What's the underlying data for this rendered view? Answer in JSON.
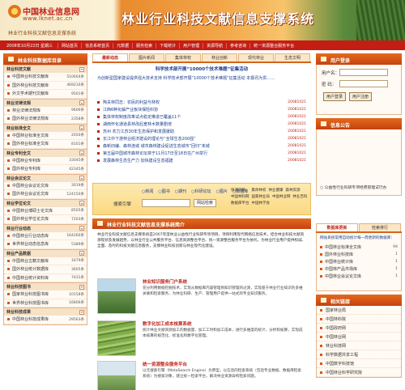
{
  "header": {
    "logo_name": "中国林业信息网",
    "logo_url": "www.lknet.ac.cn",
    "logo_slogan": "林业行业科技文献信息支撑系统",
    "title": "林业行业科技文献信息支撑系统"
  },
  "nav": {
    "date": "2008年10月22日 星期三",
    "items": [
      "网站首页",
      "信息系统首页",
      "元数据",
      "服务检索",
      "下载统计",
      "用户管理",
      "资源导航",
      "参考咨询",
      "统一资源整合服务平台"
    ]
  },
  "left": {
    "title": "林业科技数据库目录",
    "sections": [
      {
        "name": "林业科技文献",
        "rows": [
          {
            "t": "中国林业科技文献库",
            "n": "510604条"
          },
          {
            "t": "国外林业科技文献库",
            "n": "469210条"
          },
          {
            "t": "外文学术期刊文献库",
            "n": "9501条"
          }
        ]
      },
      {
        "name": "林业法律法规",
        "rows": [
          {
            "t": "林业法律法规库",
            "n": "9606条"
          },
          {
            "t": "国外林业法律法规库",
            "n": "2358条"
          }
        ]
      },
      {
        "name": "林业标准全文",
        "rows": [
          {
            "t": "中国林业标准全文库",
            "n": "2050条"
          },
          {
            "t": "国外林业标准全文库",
            "n": "8101条"
          }
        ]
      },
      {
        "name": "林业专利全文",
        "rows": [
          {
            "t": "中国林业专利库",
            "n": "33045条"
          },
          {
            "t": "国外林业专利库",
            "n": "42345条"
          }
        ]
      },
      {
        "name": "林业会议论文",
        "rows": [
          {
            "t": "中国林业会议论文库",
            "n": "3019条"
          },
          {
            "t": "国外林业会议论文库",
            "n": "124150条"
          }
        ]
      },
      {
        "name": "林业学位论文",
        "rows": [
          {
            "t": "中国林业博硕士论文库",
            "n": "8505条"
          },
          {
            "t": "国外林业学位论文库",
            "n": "7203条"
          }
        ]
      },
      {
        "name": "林业行业动态",
        "rows": [
          {
            "t": "中国林业行业动态库",
            "n": "164260条"
          },
          {
            "t": "世界林业动态信息库",
            "n": "5389条"
          }
        ]
      },
      {
        "name": "林业产品数据",
        "rows": [
          {
            "t": "中国林业古籍文献库",
            "n": "1679条"
          },
          {
            "t": "国外林业统计数据库",
            "n": "3605条"
          },
          {
            "t": "中国林业统计资料库",
            "n": "7431条"
          }
        ]
      },
      {
        "name": "林业科技图书",
        "rows": [
          {
            "t": "国家林业科技图书库",
            "n": "10158条"
          },
          {
            "t": "世界林业科技图书库",
            "n": "16806条"
          }
        ]
      },
      {
        "name": "林业科技成果",
        "rows": [
          {
            "t": "中国林业科技成果库",
            "n": "29563条"
          }
        ]
      }
    ]
  },
  "center": {
    "tabs": [
      "最新动态",
      "图片新闻",
      "集体林权",
      "林业创新",
      "现代林业",
      "生态文明"
    ],
    "announce_title": "科学技术部开展“10000个技术难题”征集活动",
    "announce_body": "为创新型国家建设提供强大技术支持 科学技术部开展“10000个技术难题”征集活动 本报讯为贯……",
    "news": [
      {
        "t": "陶关林同志：农民的利益与林权",
        "d": "20081021"
      },
      {
        "t": "江西6种化解产业板块保险科协",
        "d": "20081021"
      },
      {
        "t": "集体林权制度改革试点稳定推进已覆盖11个",
        "d": "20081021"
      },
      {
        "t": "湖南怀化通道县林改后宽林木数量剧增",
        "d": "20081021"
      },
      {
        "t": "苏州 农力江苏30年生态保护和发展援助",
        "d": "20081021"
      },
      {
        "t": "长江中下游林业经济建设的理论与“全球生态200强”",
        "d": "20081021"
      },
      {
        "t": "森新旧编、森林连城 城市森林建设促进生态城市“回归”未城",
        "d": "20081021"
      },
      {
        "t": "第五届中国城市森林论坛将于11月17日至18日在广州举行",
        "d": "20081021"
      },
      {
        "t": "发展森林生态生产力 加快建设生态福建",
        "d": "20081021"
      }
    ],
    "search_cats": [
      "新闻",
      "图书",
      "期刊",
      "科研论坛",
      "图片",
      "数据库"
    ],
    "search_label": "搜索引擎",
    "search_btn": "网站检索",
    "search_sites_title": "快速链接：",
    "search_sites": [
      "集体林权",
      "林业健康",
      "森林资源",
      "中国林科网",
      "国家林业局",
      "中国林业网",
      "林业百科",
      "数据库平台",
      "中国林学会"
    ],
    "intro_title": "林业行业科技文献信息支撑系统简介",
    "intro_body": "林业行业科技文献信息支撑系统是2007年度林业公益性行业科研专项项目，项目利用现代网络信息技术，结合林业科技文献资源现状及发展趋势，以林业行业公共服务平台、信息资源整合平台、统一资源整合服务平台为依托，为林业行业用户提供权威、全面、及时的科技文献信息服务，支撑林业科技创新与林业现代化建设。",
    "features": [
      {
        "title": "林业知识服务门户系统",
        "body": "充分利用数据挖掘技术，实现从数据库内容管理到知识管理的过渡，实现基于林业行业知识的多维关联和检索服务，为林业科研、生产、管理用户提供一站式的专业知识服务。"
      },
      {
        "title": "数字化加工成本核算系统",
        "body": "统计林业文献资源加工的数据量、加工工时和加工成本，进行多维度的统计、分析和核算，实现成本核算的规范化、标准化和数字化管理。"
      },
      {
        "title": "统一资源整合服务平台",
        "body": "以元搜索引擎（MetaSearch Engine）为原型，以信息的检索系统（包括专业数据、数据库检索系统）为搜索对象，建立统一检索平台，解决林业资源异构检索问题。"
      }
    ]
  },
  "right": {
    "login_title": "用户登录",
    "user_label": "用户名：",
    "pass_label": "密  码：",
    "login_btn": "用户登录",
    "register_btn": "用户注册",
    "notice_title": "信息公告",
    "notice_select": "公益性行业科研专项经费管理试行办",
    "db_tabs": [
      "数据库更新",
      "检索排行"
    ],
    "db_note": "网站系统常用自动统计每一周更新的数据库：",
    "db_list": [
      {
        "t": "中国林业标准全文库",
        "n": "94"
      },
      {
        "t": "国外林业科技库",
        "n": "1"
      },
      {
        "t": "中国林业统计库",
        "n": "1"
      },
      {
        "t": "中国林产品市场库",
        "n": "1"
      },
      {
        "t": "中国林业会议论文库",
        "n": "1"
      }
    ],
    "links_title": "相关链接",
    "links": [
      "国家林业局",
      "中国林科院",
      "中国政府网",
      "中国林业网",
      "林业科技网",
      "科学数据共享工程",
      "中国数字科技馆",
      "中国林业科学研究院"
    ]
  }
}
